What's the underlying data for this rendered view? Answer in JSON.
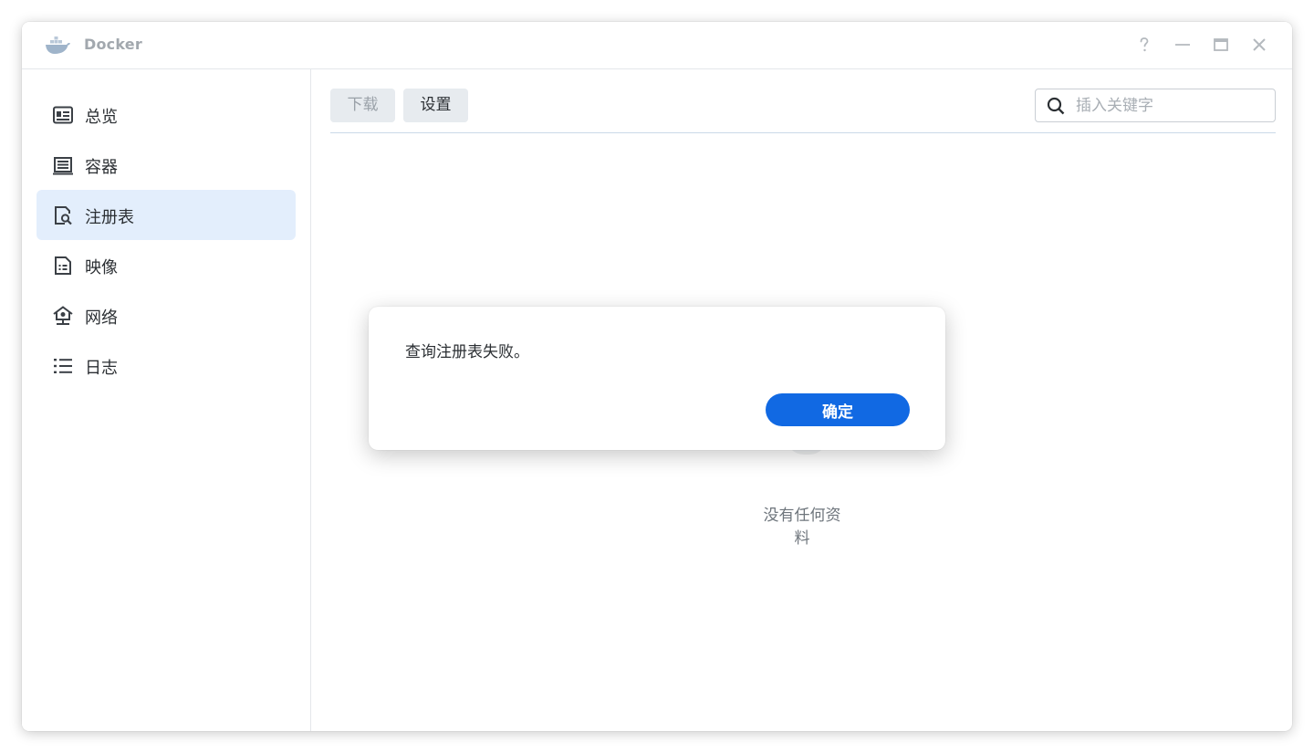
{
  "window": {
    "title": "Docker",
    "app_icon": "docker-whale-icon"
  },
  "window_controls": [
    {
      "name": "help",
      "icon": "question-icon"
    },
    {
      "name": "minimize",
      "icon": "minimize-icon"
    },
    {
      "name": "maximize",
      "icon": "maximize-icon"
    },
    {
      "name": "close",
      "icon": "close-icon"
    }
  ],
  "sidebar": {
    "items": [
      {
        "label": "总览",
        "icon": "overview-card-icon",
        "active": false
      },
      {
        "label": "容器",
        "icon": "container-list-icon",
        "active": false
      },
      {
        "label": "注册表",
        "icon": "registry-search-icon",
        "active": true
      },
      {
        "label": "映像",
        "icon": "image-document-icon",
        "active": false
      },
      {
        "label": "网络",
        "icon": "network-home-icon",
        "active": false
      },
      {
        "label": "日志",
        "icon": "log-list-icon",
        "active": false
      }
    ]
  },
  "toolbar": {
    "download_label": "下载",
    "settings_label": "设置",
    "search_placeholder": "插入关键字",
    "search_value": ""
  },
  "main": {
    "empty_text": "没有任何资料"
  },
  "dialog": {
    "message": "查询注册表失败。",
    "ok_label": "确定"
  },
  "colors": {
    "accent": "#1169e3",
    "active_nav_bg": "#e3eefc",
    "tab_bg": "#e7ebef",
    "text_primary": "#2b2f33",
    "text_muted": "#a2a8ae"
  }
}
